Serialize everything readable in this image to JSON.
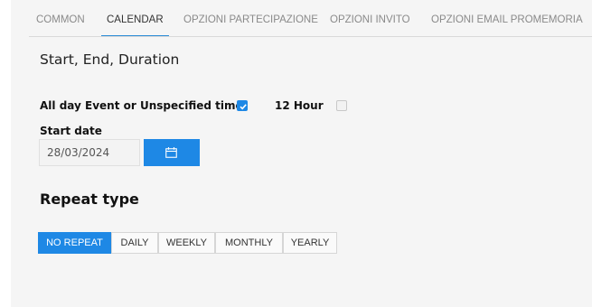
{
  "tabs": [
    {
      "label": "COMMON",
      "active": false
    },
    {
      "label": "CALENDAR",
      "active": true
    },
    {
      "label": "OPZIONI PARTECIPAZIONE",
      "active": false
    },
    {
      "label": "OPZIONI INVITO",
      "active": false
    },
    {
      "label": "OPZIONI EMAIL PROMEMORIA",
      "active": false
    }
  ],
  "section_title": "Start, End, Duration",
  "options": {
    "all_day_label": "All day Event or Unspecified time",
    "all_day_checked": true,
    "twelve_hour_label": "12 Hour",
    "twelve_hour_checked": false
  },
  "start_date": {
    "label": "Start date",
    "value": "28/03/2024",
    "button_icon": "calendar-icon"
  },
  "repeat": {
    "title": "Repeat type",
    "options": [
      "NO REPEAT",
      "DAILY",
      "WEEKLY",
      "MONTHLY",
      "YEARLY"
    ],
    "selected": "NO REPEAT"
  },
  "colors": {
    "accent": "#1e88e5",
    "panel_bg": "#f5f5f5",
    "tab_underline": "#2b8cd6"
  }
}
